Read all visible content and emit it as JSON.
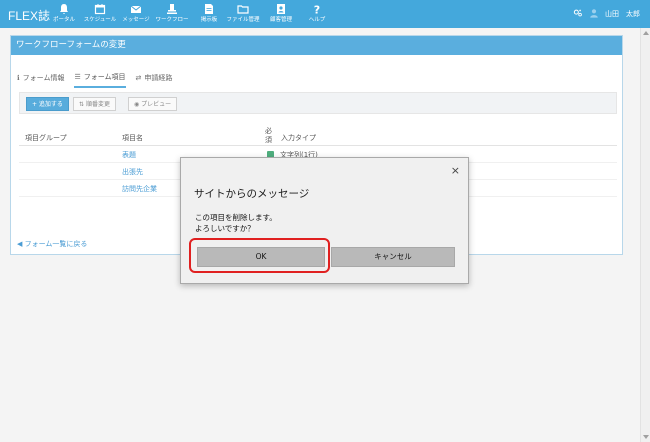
{
  "header": {
    "brand": "FLEX誌",
    "nav": [
      {
        "label": "ポータル",
        "icon": "bell-icon"
      },
      {
        "label": "スケジュール",
        "icon": "calendar-icon"
      },
      {
        "label": "メッセージ",
        "icon": "mail-icon"
      },
      {
        "label": "ワークフロー",
        "icon": "workflow-icon"
      },
      {
        "label": "掲示板",
        "icon": "board-icon"
      },
      {
        "label": "ファイル管理",
        "icon": "folder-icon"
      },
      {
        "label": "顧客管理",
        "icon": "customer-icon"
      },
      {
        "label": "ヘルプ",
        "icon": "help-icon"
      }
    ],
    "settings_icon": "settings-icon",
    "user_icon": "user-icon",
    "user_name": "山田　太郎"
  },
  "panel": {
    "title": "ワークフローフォームの変更",
    "tabs": [
      {
        "label": "フォーム情報",
        "icon": "info-icon",
        "active": false
      },
      {
        "label": "フォーム項目",
        "icon": "list-icon",
        "active": true
      },
      {
        "label": "申請経路",
        "icon": "route-icon",
        "active": false
      }
    ],
    "toolbar": {
      "add": "+ 追加する",
      "reorder": "順番変更",
      "preview": "プレビュー"
    },
    "columns": {
      "group": "項目グループ",
      "name": "項目名",
      "required_1": "必",
      "required_2": "須",
      "type": "入力タイプ"
    },
    "rows": [
      {
        "name": "表題",
        "required": true,
        "type": "文字列(1行)"
      },
      {
        "name": "出張先",
        "required": false,
        "type": ""
      },
      {
        "name": "訪問先企業",
        "required": false,
        "type": ""
      }
    ],
    "back_link": "フォーム一覧に戻る"
  },
  "dialog": {
    "title": "サイトからのメッセージ",
    "message_line1": "この項目を削除します。",
    "message_line2": "よろしいですか？",
    "ok": "OK",
    "cancel": "キャンセル",
    "close": "×"
  },
  "colors": {
    "header_bg": "#44a8dc",
    "panel_header_bg": "#5aaede",
    "link": "#4a9cd4",
    "highlight": "#e02020"
  }
}
